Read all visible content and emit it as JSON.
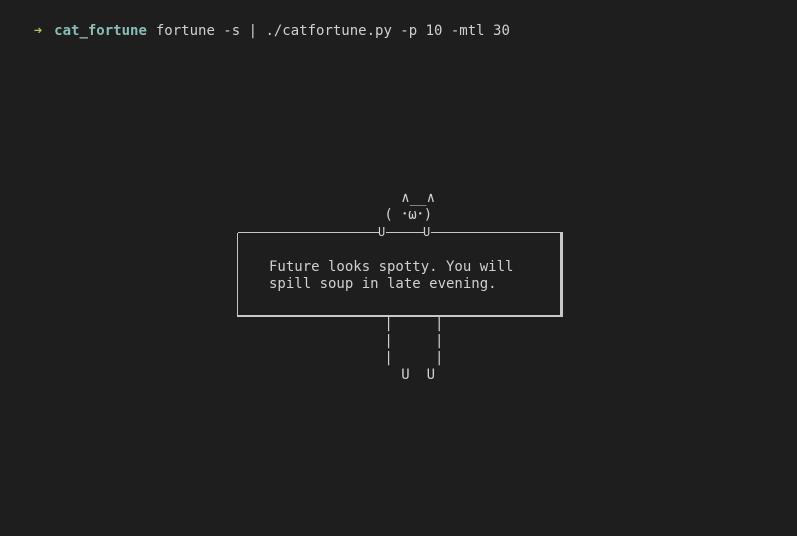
{
  "terminal": {
    "prompt_symbol": "➜",
    "directory": "cat_fortune",
    "command": "fortune -s | ./catfortune.py -p 10 -mtl 30"
  },
  "cat": {
    "ears": "   ∧__∧",
    "face": " ( ･ω･)",
    "paw_left": "U",
    "paw_right": "U",
    "legs_1": " |     |",
    "legs_2": " |     |",
    "legs_3": " |     |",
    "feet": "   U  U"
  },
  "fortune": {
    "line1": "Future looks spotty. You will",
    "line2": "spill soup in late evening."
  },
  "colors": {
    "background": "#1e1e1e",
    "prompt_arrow": "#b5bd68",
    "directory": "#8abeb7",
    "text": "#d0d0d0"
  }
}
